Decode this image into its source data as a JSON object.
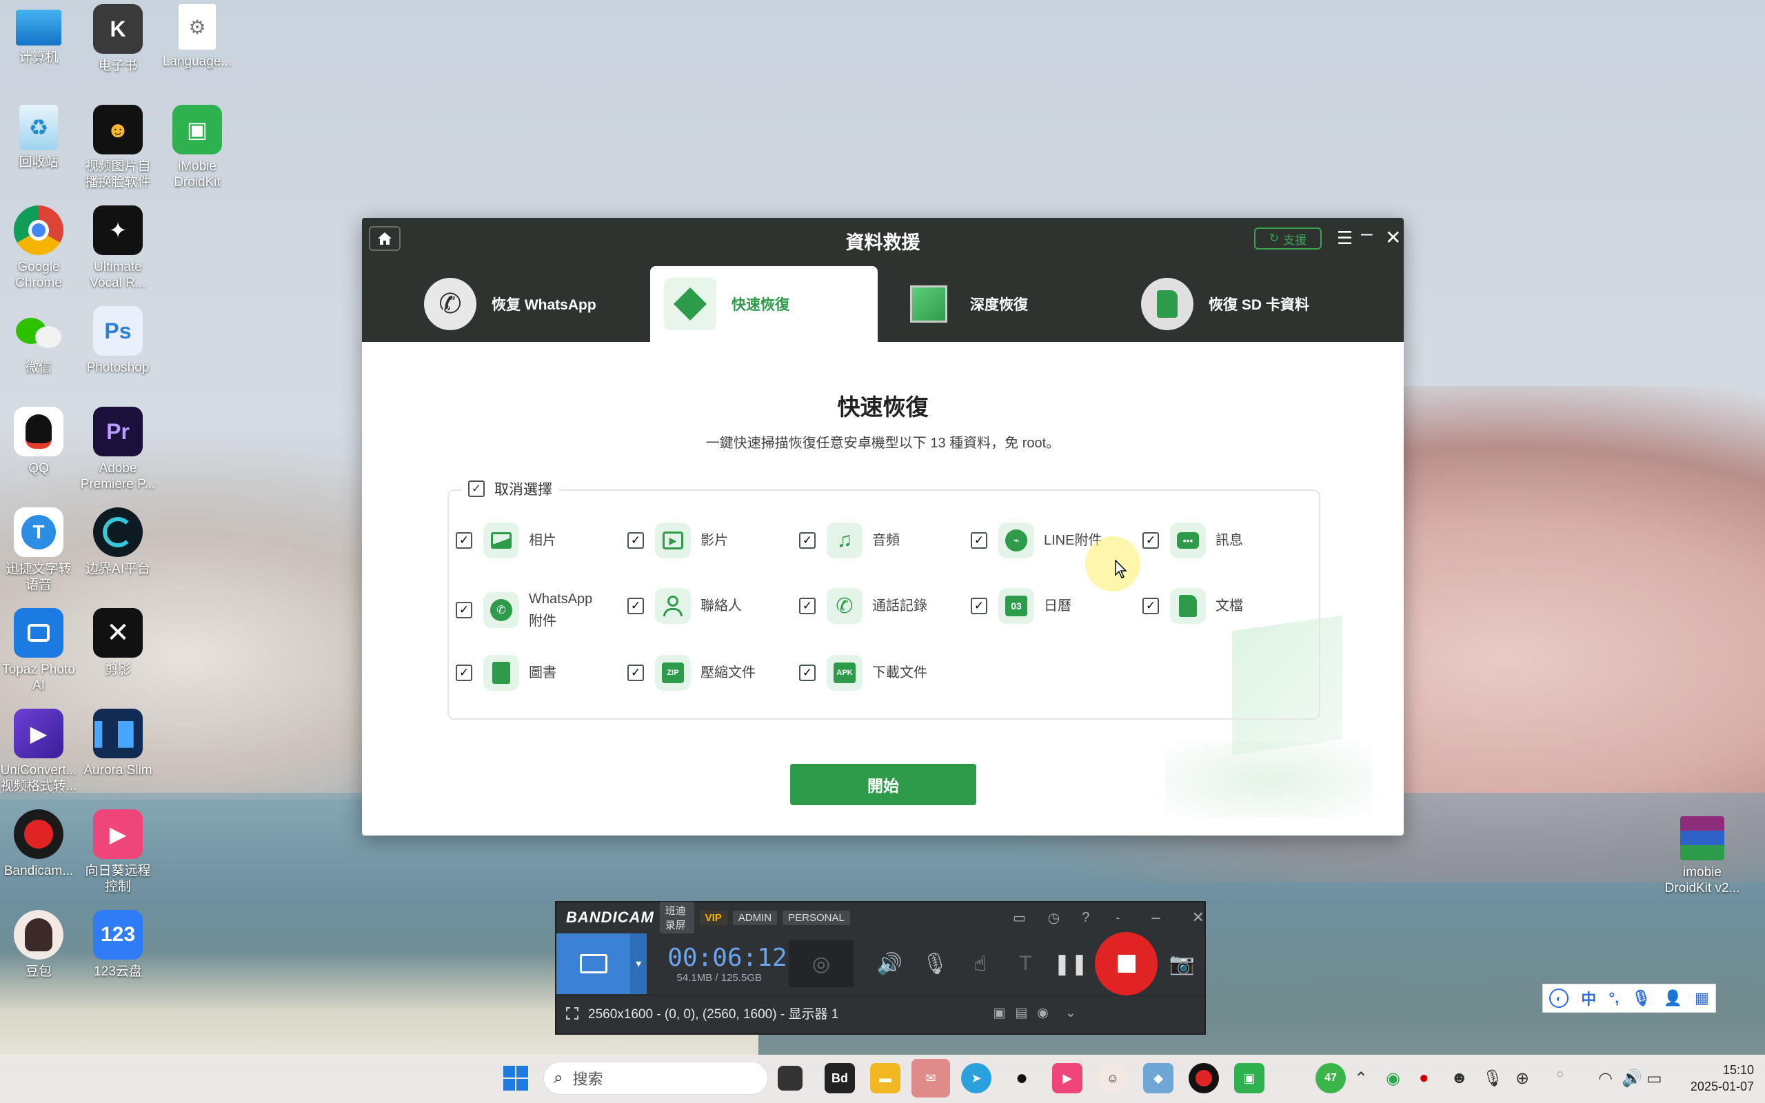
{
  "desktop": {
    "icons": [
      {
        "label": "计算机"
      },
      {
        "label": "电子书"
      },
      {
        "label": "Language..."
      },
      {
        "label": "回收站"
      },
      {
        "label": "视频图片自播换脸软件"
      },
      {
        "label": "iMobie DroidKit"
      },
      {
        "label": "Google Chrome"
      },
      {
        "label": "Ultimate Vocal R..."
      },
      {
        "label": "微信"
      },
      {
        "label": "Photoshop"
      },
      {
        "label": "QQ"
      },
      {
        "label": "Adobe Premiere P..."
      },
      {
        "label": "迅捷文字转语音"
      },
      {
        "label": "边界AI平台"
      },
      {
        "label": "Topaz Photo AI"
      },
      {
        "label": "剪影"
      },
      {
        "label": "UniConvert... 视频格式转..."
      },
      {
        "label": "Aurora Slim"
      },
      {
        "label": "Bandicam..."
      },
      {
        "label": "向日葵远程控制"
      },
      {
        "label": "豆包"
      },
      {
        "label": "123云盘"
      },
      {
        "label": "imobie DroidKit v2..."
      }
    ],
    "icon_glyphs": {
      "photoshop": "Ps",
      "premiere": "Pr",
      "pan123": "123"
    }
  },
  "app": {
    "title": "資料救援",
    "support_label": "支援",
    "tabs": [
      {
        "label": "恢复 WhatsApp"
      },
      {
        "label": "快速恢復"
      },
      {
        "label": "深度恢復"
      },
      {
        "label": "恢復 SD 卡資料"
      }
    ],
    "heading": "快速恢復",
    "subtitle": "一鍵快速掃描恢復任意安卓機型以下 13 種資料，免 root。",
    "select_all_label": "取消選擇",
    "items": [
      {
        "label": "相片",
        "checked": true,
        "icon": "photo-icon"
      },
      {
        "label": "影片",
        "checked": true,
        "icon": "video-icon"
      },
      {
        "label": "音頻",
        "checked": true,
        "icon": "music-icon"
      },
      {
        "label": "LINE附件",
        "checked": true,
        "icon": "line-icon"
      },
      {
        "label": "訊息",
        "checked": true,
        "icon": "message-icon"
      },
      {
        "label": "WhatsApp 附件",
        "checked": true,
        "icon": "whatsapp-icon"
      },
      {
        "label": "聯絡人",
        "checked": true,
        "icon": "contact-icon"
      },
      {
        "label": "通話記錄",
        "checked": true,
        "icon": "phone-icon"
      },
      {
        "label": "日曆",
        "checked": true,
        "icon": "calendar-icon",
        "glyph": "03"
      },
      {
        "label": "文檔",
        "checked": true,
        "icon": "document-icon"
      },
      {
        "label": "圖書",
        "checked": true,
        "icon": "book-icon"
      },
      {
        "label": "壓縮文件",
        "checked": true,
        "icon": "zip-icon",
        "glyph": "ZIP"
      },
      {
        "label": "下載文件",
        "checked": true,
        "icon": "apk-icon",
        "glyph": "APK"
      }
    ],
    "start_label": "開始",
    "accent": "#2e9b4a"
  },
  "bandicam": {
    "logo": "BANDICAM",
    "brand_cn": "班迪录屏",
    "vip": "VIP",
    "admin": "ADMIN",
    "personal": "PERSONAL",
    "timer": "00:06:12",
    "size": "54.1MB / 125.5GB",
    "status": "2560x1600 - (0, 0), (2560, 1600) - 显示器 1",
    "rec_color": "#e02424"
  },
  "ime": {
    "zh": "中"
  },
  "taskbar": {
    "search_placeholder": "搜索",
    "clock_time": "15:10",
    "clock_date": "2025-01-07",
    "badge_count": "47"
  }
}
